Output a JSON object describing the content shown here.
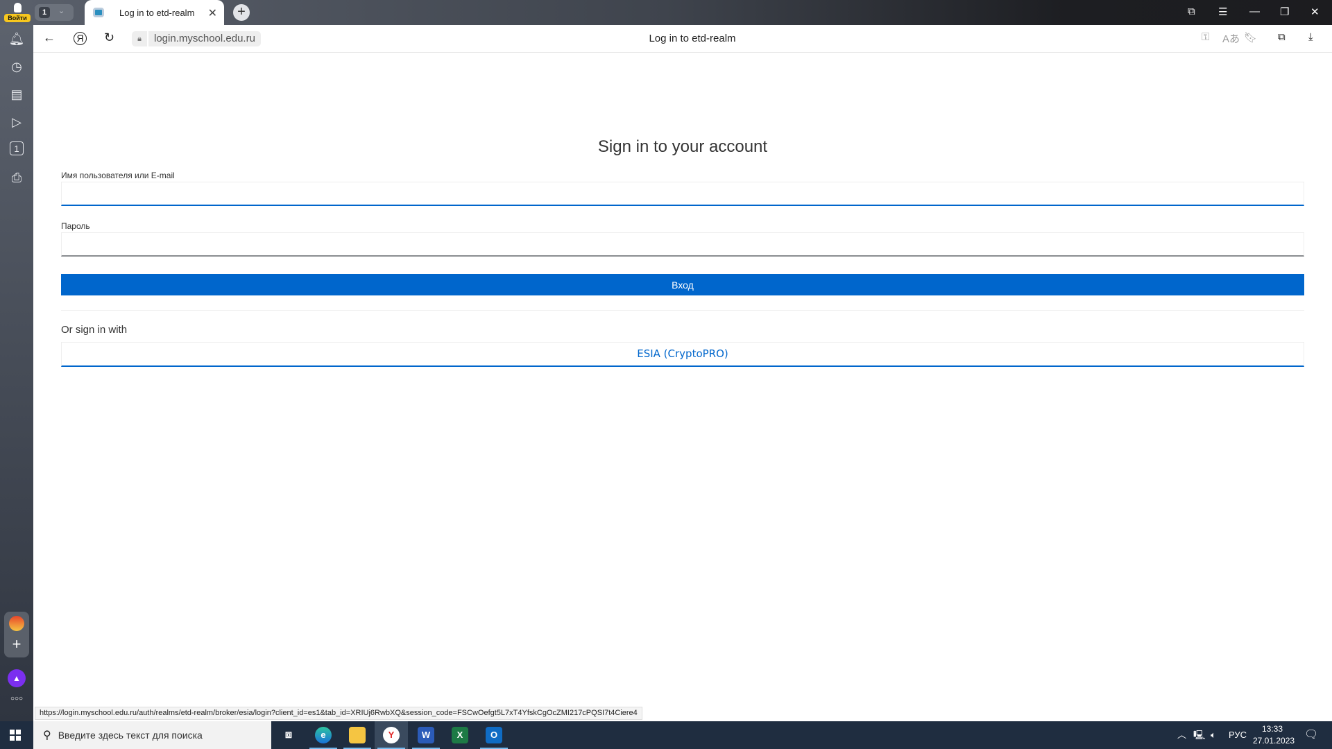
{
  "browser": {
    "login_badge": "Войти",
    "tab_count": "1",
    "tab_title": "Log in to etd-realm",
    "url": "login.myschool.edu.ru",
    "page_title": "Log in to etd-realm",
    "status_url": "https://login.myschool.edu.ru/auth/realms/etd-realm/broker/esia/login?client_id=es1&tab_id=XRIUj6RwbXQ&session_code=FSCwOefgt5L7xT4YfskCgOcZMI217cPQSI7t4Ciere4"
  },
  "form": {
    "heading": "Sign in to your account",
    "username_label": "Имя пользователя или E-mail",
    "username_value": "",
    "password_label": "Пароль",
    "password_value": "",
    "submit_label": "Вход",
    "or_sign_in": "Or sign in with",
    "provider_label": "ESIA (CryptoPRO)"
  },
  "taskbar": {
    "search_placeholder": "Введите здесь текст для поиска",
    "language": "РУС",
    "time": "13:33",
    "date": "27.01.2023"
  },
  "colors": {
    "accent": "#0066cc",
    "taskbar": "#1f2d40"
  }
}
